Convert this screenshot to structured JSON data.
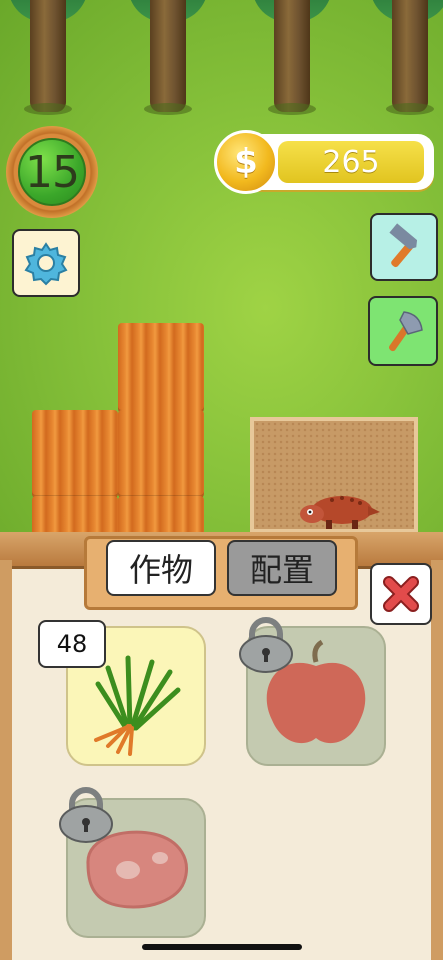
{
  "hud": {
    "level": "15",
    "coins": "265",
    "coin_icon": "coin-dollar-icon"
  },
  "tools": {
    "settings_icon": "gear-icon",
    "hammer_icon": "hammer-icon",
    "axe_icon": "axe-icon"
  },
  "panel": {
    "tabs": [
      {
        "label": "作物",
        "selected": true
      },
      {
        "label": "配置",
        "selected": false
      }
    ],
    "close_icon": "close-x-icon",
    "items": [
      {
        "name_icon": "grass-bundle-icon",
        "count": "48",
        "locked": false
      },
      {
        "name_icon": "apple-icon",
        "locked": true
      },
      {
        "name_icon": "meat-icon",
        "locked": true
      }
    ]
  },
  "colors": {
    "grass": "#86c13a",
    "crop": "#e98a33",
    "close_red": "#e24b4b",
    "coin_yellow": "#f2b91e"
  }
}
